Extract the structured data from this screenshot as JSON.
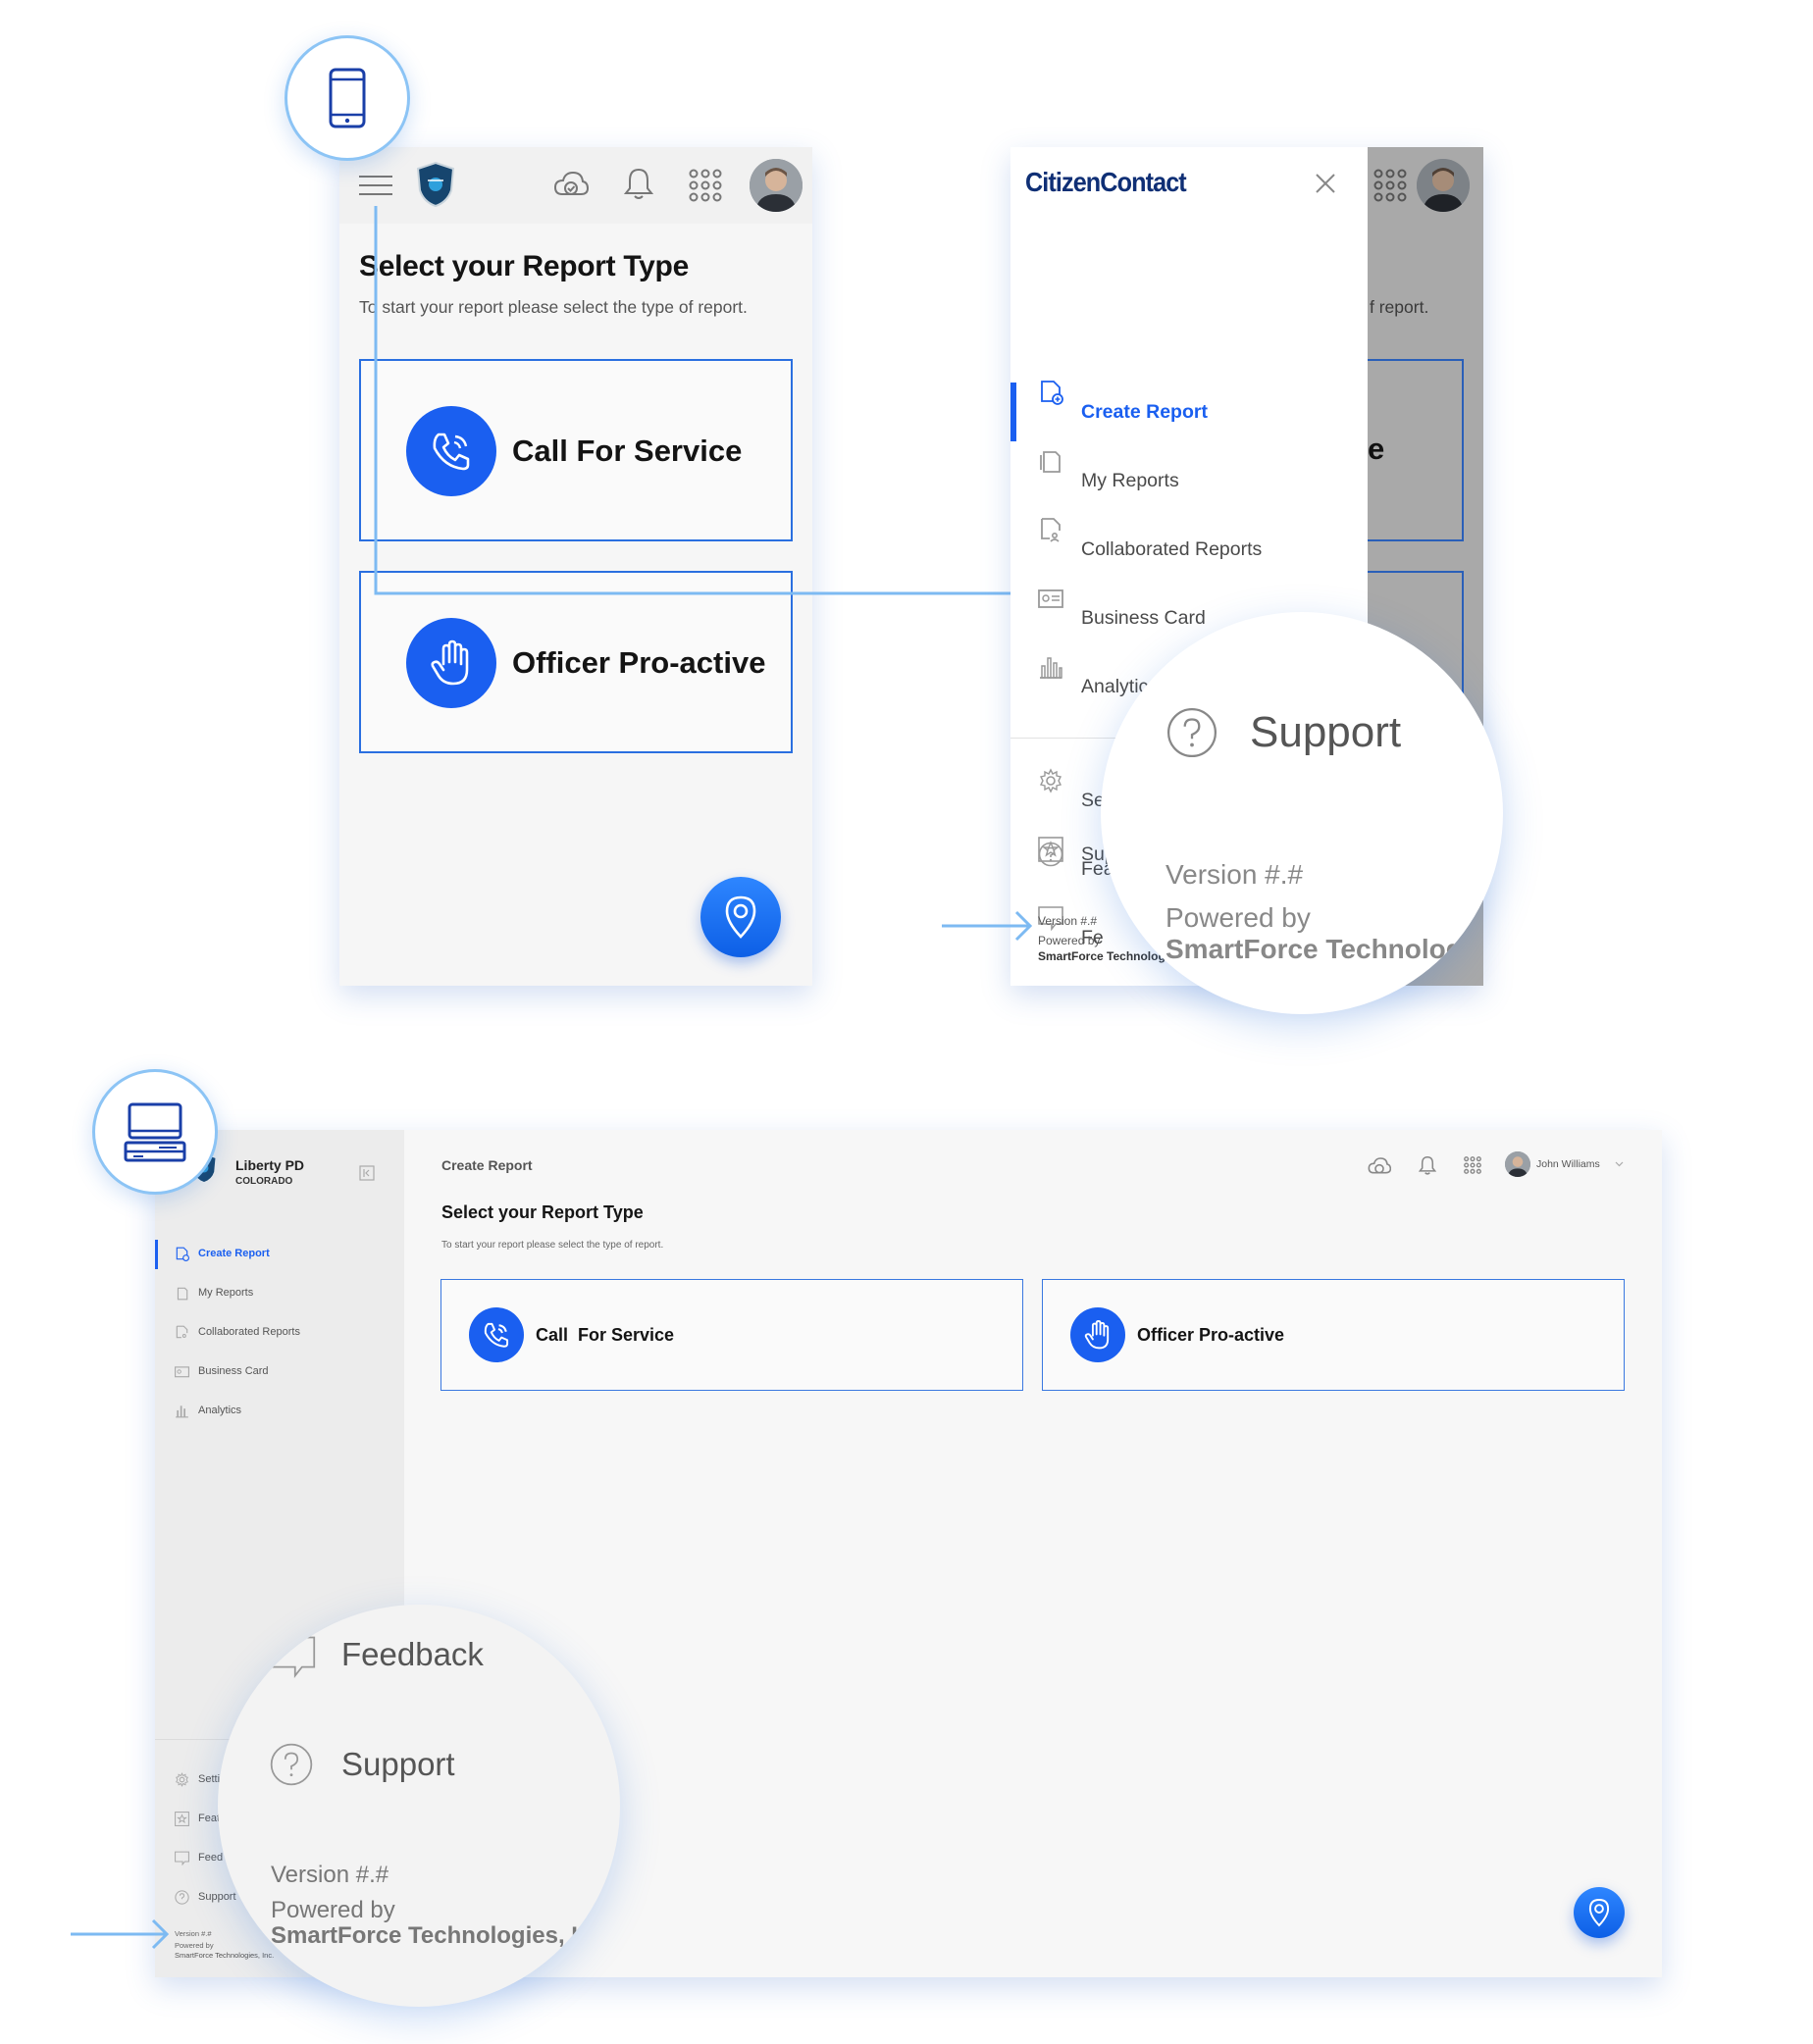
{
  "mobile": {
    "title": "Select your Report Type",
    "subtitle": "To start your report please select the type of report.",
    "cards": [
      {
        "label": "Call For Service",
        "icon": "phone-icon"
      },
      {
        "label": "Officer Pro-active",
        "icon": "hand-icon"
      }
    ],
    "header_icons": [
      "menu-icon",
      "cloud-check-icon",
      "bell-icon",
      "apps-grid-icon"
    ]
  },
  "drawer": {
    "brand": "CitizenContact",
    "items": [
      {
        "label": "Create Report",
        "icon": "create-report-icon",
        "active": true
      },
      {
        "label": "My Reports",
        "icon": "my-reports-icon"
      },
      {
        "label": "Collaborated Reports",
        "icon": "collaborated-reports-icon"
      },
      {
        "label": "Business Card",
        "icon": "business-card-icon"
      },
      {
        "label": "Analytics",
        "icon": "analytics-icon"
      }
    ],
    "secondary": [
      {
        "label": "Settings",
        "visible": "Settings"
      },
      {
        "label": "Featu",
        "visible": "Featu"
      },
      {
        "label": "Fe",
        "visible": "Fe"
      },
      {
        "label": "Sup",
        "visible": "Sup"
      }
    ],
    "background_fragments": {
      "subtitle_tail": "f report.",
      "card_letter": "e"
    },
    "version": "Version #.#",
    "powered_by": "Powered by",
    "company": "SmartForce Technolog",
    "magnified": {
      "support": "Support",
      "version": "Version #.#",
      "powered_by": "Powered by",
      "company": "SmartForce Technolog"
    }
  },
  "desktop": {
    "org_name": "Liberty PD",
    "org_region": "COLORADO",
    "breadcrumb": "Create Report",
    "title": "Select your Report Type",
    "subtitle": "To start your report please select the type of report.",
    "user_name": "John Williams",
    "cards": [
      {
        "label": "Call  For Service"
      },
      {
        "label": "Officer Pro-active"
      }
    ],
    "sidebar_items": [
      {
        "label": "Create Report",
        "active": true
      },
      {
        "label": "My Reports"
      },
      {
        "label": "Collaborated Reports"
      },
      {
        "label": "Business Card"
      },
      {
        "label": "Analytics"
      }
    ],
    "sidebar_bottom": [
      {
        "label": "Setti"
      },
      {
        "label": "Feat"
      },
      {
        "label": "Feed"
      },
      {
        "label": "Support"
      }
    ],
    "version": "Version #.#",
    "powered_by": "Powered by",
    "company": "SmartForce Technologies, Inc.",
    "magnified": {
      "feedback": "Feedback",
      "support": "Support",
      "version": "Version #.#",
      "powered_by": "Powered by",
      "company": "SmartForce Technologies, Inc"
    }
  },
  "colors": {
    "accent": "#1a5ff0",
    "connector": "#7dbaf2",
    "sidebar": "#ececec"
  }
}
